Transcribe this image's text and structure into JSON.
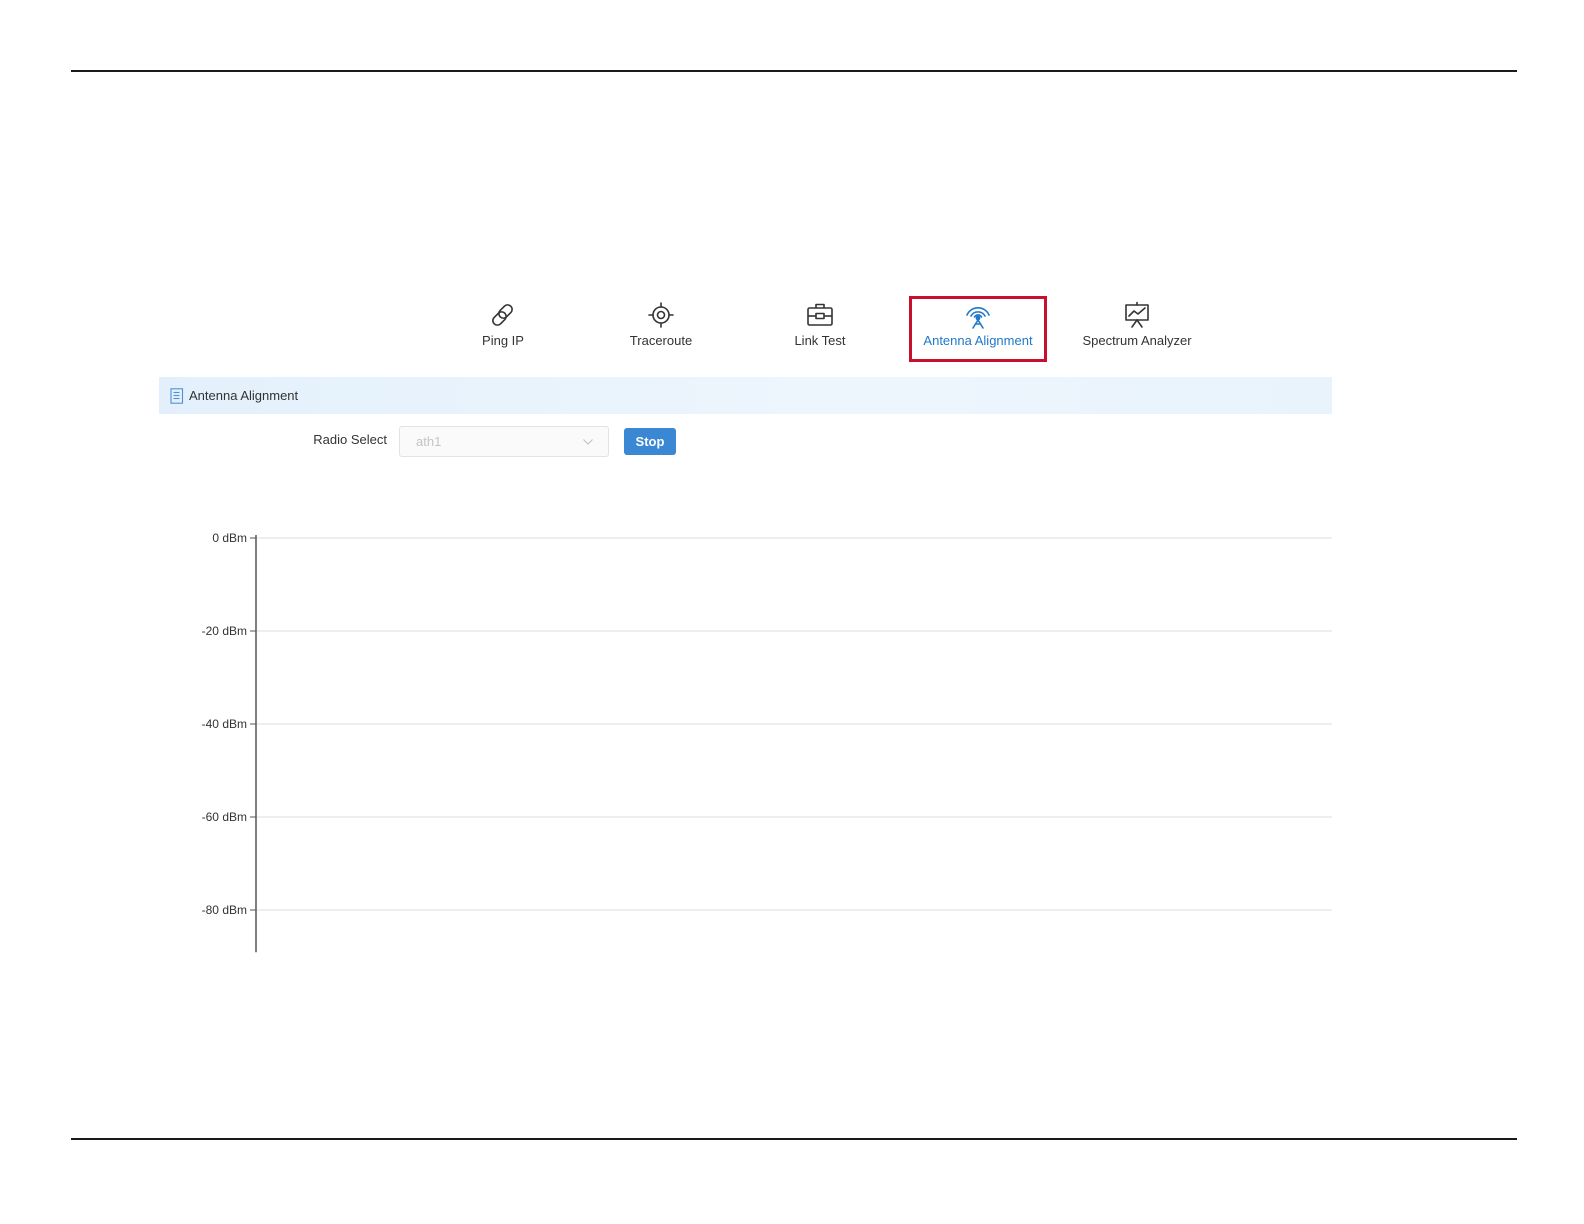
{
  "toolbar": {
    "tabs": [
      {
        "label": "Ping IP",
        "icon": "link-icon",
        "active": false
      },
      {
        "label": "Traceroute",
        "icon": "crosshair-icon",
        "active": false
      },
      {
        "label": "Link Test",
        "icon": "toolbox-icon",
        "active": false
      },
      {
        "label": "Antenna Alignment",
        "icon": "antenna-signal-icon",
        "active": true
      },
      {
        "label": "Spectrum Analyzer",
        "icon": "presentation-chart-icon",
        "active": false
      }
    ]
  },
  "panel": {
    "title": "Antenna Alignment",
    "radio_select_label": "Radio Select",
    "radio_select_value": "ath1",
    "stop_label": "Stop"
  },
  "colors": {
    "accent": "#3a87d4",
    "active_text": "#1f78c8",
    "highlight_border": "#c8102e",
    "panel_header_bg": "#e3f0fb"
  },
  "chart_data": {
    "type": "line",
    "title": "",
    "xlabel": "",
    "ylabel": "",
    "ylim": [
      -88,
      0
    ],
    "y_ticks": [
      0,
      -20,
      -40,
      -60,
      -80
    ],
    "y_tick_labels": [
      "0 dBm",
      "-20 dBm",
      "-40 dBm",
      "-60 dBm",
      "-80 dBm"
    ],
    "grid": true,
    "series": []
  }
}
